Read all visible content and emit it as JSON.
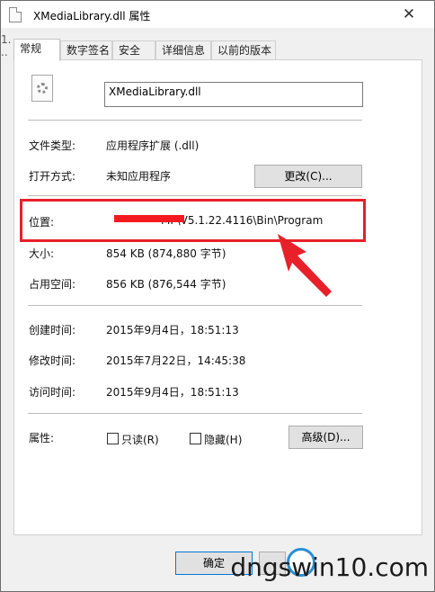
{
  "window": {
    "title": "XMediaLibrary.dll 属性"
  },
  "tabs": [
    "常规",
    "数字签名",
    "安全",
    "详细信息",
    "以前的版本"
  ],
  "file": {
    "name": "XMediaLibrary.dll"
  },
  "props": {
    "type_label": "文件类型:",
    "type_value": "应用程序扩展 (.dll)",
    "open_label": "打开方式:",
    "open_value": "未知应用程序",
    "change_button": "更改(C)...",
    "location_label": "位置:",
    "location_value": "MP\\V5.1.22.4116\\Bin\\Program",
    "size_label": "大小:",
    "size_value": "854 KB (874,880 字节)",
    "disk_label": "占用空间:",
    "disk_value": "856 KB (876,544 字节)",
    "created_label": "创建时间:",
    "created_value": "2015年9月4日，18:51:13",
    "modified_label": "修改时间:",
    "modified_value": "2015年7月22日，14:45:38",
    "accessed_label": "访问时间:",
    "accessed_value": "2015年9月4日，18:51:13",
    "attr_label": "属性:",
    "readonly_label": "只读(R)",
    "hidden_label": "隐藏(H)",
    "advanced_button": "高级(D)..."
  },
  "footer": {
    "ok_button": "确定"
  },
  "watermark": "dngswin10.com",
  "colors": {
    "annotation_red": "#e8202a",
    "window_bg": "#f0f0f0",
    "panel_bg": "#ffffff"
  }
}
